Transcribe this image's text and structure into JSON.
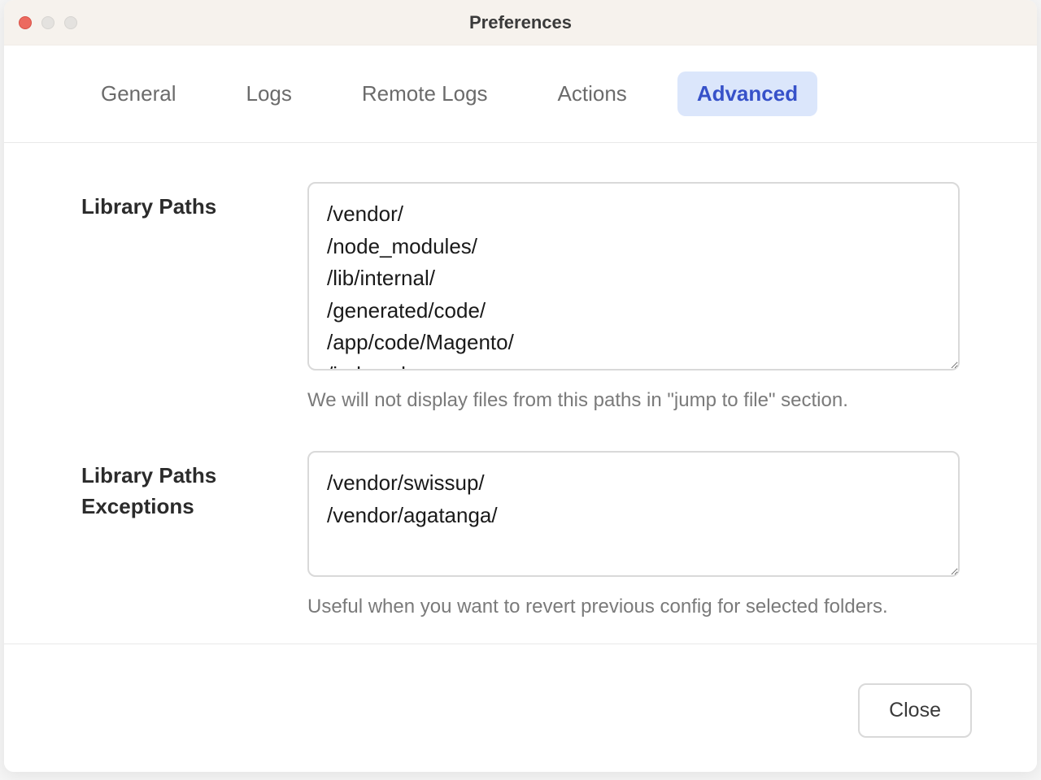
{
  "window": {
    "title": "Preferences"
  },
  "tabs": {
    "general": "General",
    "logs": "Logs",
    "remote_logs": "Remote Logs",
    "actions": "Actions",
    "advanced": "Advanced"
  },
  "fields": {
    "library_paths": {
      "label": "Library Paths",
      "value": "/vendor/\n/node_modules/\n/lib/internal/\n/generated/code/\n/app/code/Magento/\n/index.php",
      "help": "We will not display files from this paths in \"jump to file\" section."
    },
    "library_paths_exceptions": {
      "label": "Library Paths Exceptions",
      "value": "/vendor/swissup/\n/vendor/agatanga/",
      "help": "Useful when you want to revert previous config for selected folders."
    }
  },
  "footer": {
    "close_label": "Close"
  }
}
